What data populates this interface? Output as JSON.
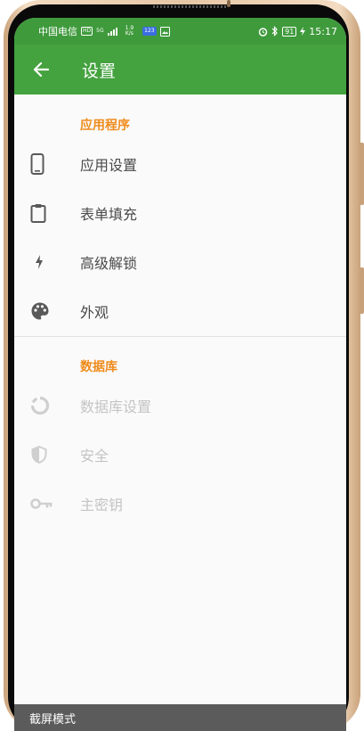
{
  "statusbar": {
    "carrier": "中国电信",
    "hd": "HD",
    "net_type": "5G",
    "speed_value": "1.9",
    "speed_unit": "K/s",
    "badge": "123",
    "battery": "91",
    "time": "15:17"
  },
  "appbar": {
    "title": "设置"
  },
  "sections": [
    {
      "title": "应用程序",
      "items": [
        {
          "label": "应用设置",
          "icon": "phone-icon"
        },
        {
          "label": "表单填充",
          "icon": "clipboard-icon"
        },
        {
          "label": "高级解锁",
          "icon": "lightning-icon"
        },
        {
          "label": "外观",
          "icon": "palette-icon"
        }
      ]
    },
    {
      "title": "数据库",
      "items": [
        {
          "label": "数据库设置",
          "icon": "database-ring-icon"
        },
        {
          "label": "安全",
          "icon": "shield-icon"
        },
        {
          "label": "主密钥",
          "icon": "key-icon"
        }
      ]
    }
  ],
  "toast": "截屏模式",
  "colors": {
    "statusbar": "#3f9a3c",
    "appbar": "#44a23f",
    "section_title": "#ef8c1d",
    "disabled": "#c4c4c4"
  }
}
